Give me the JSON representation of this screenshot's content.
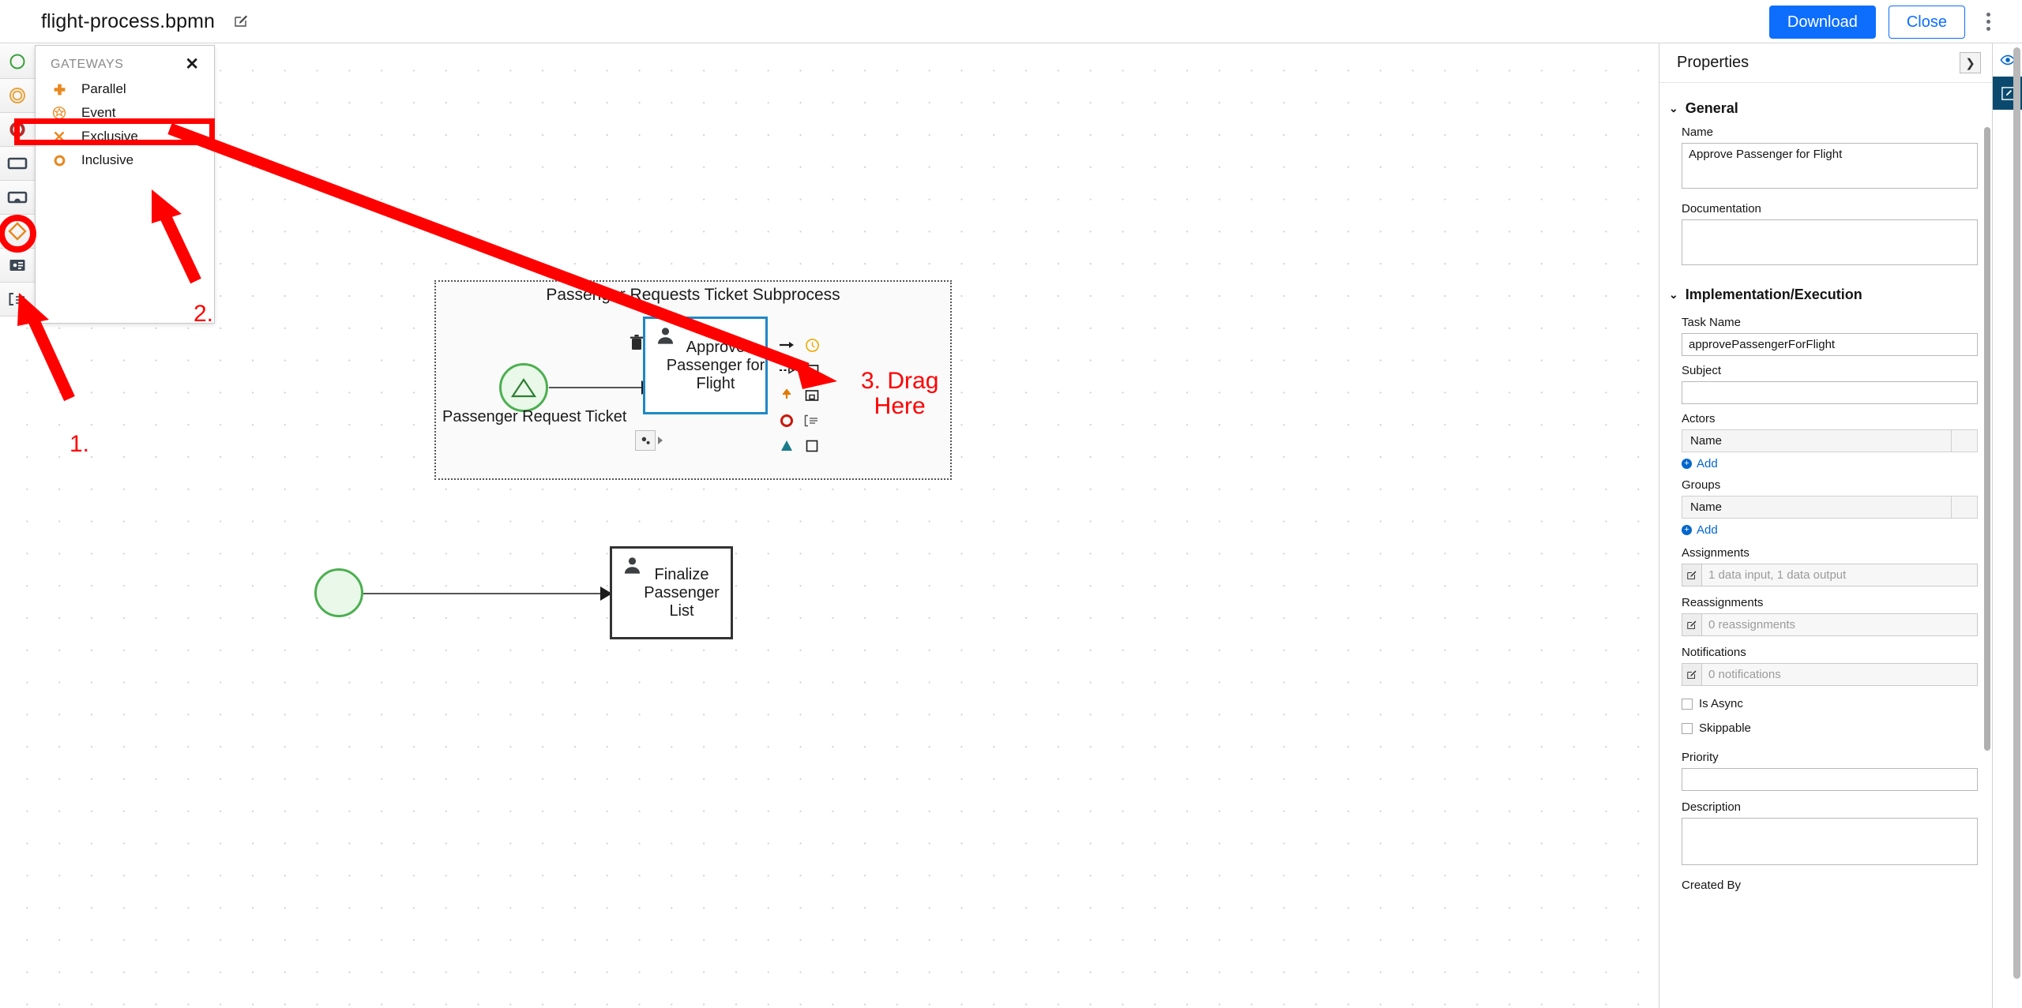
{
  "header": {
    "file_name": "flight-process.bpmn",
    "edit_icon": "edit-pencil-icon",
    "download_label": "Download",
    "close_label": "Close",
    "kebab_icon": "kebab-menu-icon"
  },
  "palette": {
    "items": [
      {
        "name": "start-event-tool",
        "icon": "green-circle-icon"
      },
      {
        "name": "intermediate-event-tool",
        "icon": "orange-double-circle-icon"
      },
      {
        "name": "end-event-tool",
        "icon": "red-circle-icon"
      },
      {
        "name": "task-tool",
        "icon": "rectangle-icon"
      },
      {
        "name": "subprocess-tool",
        "icon": "subprocess-icon"
      },
      {
        "name": "gateway-tool",
        "icon": "orange-diamond-icon"
      },
      {
        "name": "data-object-tool",
        "icon": "data-object-icon"
      },
      {
        "name": "artifact-tool",
        "icon": "artifact-icon"
      }
    ]
  },
  "flyout": {
    "title": "GATEWAYS",
    "close_icon": "close-icon",
    "items": [
      {
        "label": "Parallel",
        "icon": "plus-gateway-icon"
      },
      {
        "label": "Event",
        "icon": "event-gateway-icon"
      },
      {
        "label": "Exclusive",
        "icon": "exclusive-gateway-icon"
      },
      {
        "label": "Inclusive",
        "icon": "inclusive-gateway-icon"
      }
    ],
    "selected": "Exclusive"
  },
  "diagram": {
    "subprocess": {
      "title": "Passenger Requests Ticket Subprocess",
      "start_event_label": "Passenger Request Ticket",
      "task_label": "Approve Passenger for Flight"
    },
    "second_flow": {
      "task_label": "Finalize Passenger List"
    },
    "context_pad": [
      {
        "name": "delete-icon"
      },
      {
        "name": "sequence-flow-icon"
      },
      {
        "name": "timer-event-icon"
      },
      {
        "name": "association-icon"
      },
      {
        "name": "task-icon"
      },
      {
        "name": "gateway-icon"
      },
      {
        "name": "subprocess-icon"
      },
      {
        "name": "end-event-icon"
      },
      {
        "name": "text-annotation-icon"
      },
      {
        "name": "data-input-icon"
      },
      {
        "name": "data-object-icon"
      },
      {
        "name": "morph-icon"
      }
    ]
  },
  "annotations": [
    {
      "id": "step1",
      "text": "1."
    },
    {
      "id": "step2",
      "text": "2."
    },
    {
      "id": "step3",
      "text": "3. Drag\nHere"
    }
  ],
  "annotation_color": "#ff0000",
  "properties": {
    "panel_title": "Properties",
    "collapse_icon": "chevron-right-icon",
    "sections": [
      {
        "name": "General",
        "fields": [
          {
            "label": "Name",
            "value": "Approve Passenger for Flight",
            "type": "textarea"
          },
          {
            "label": "Documentation",
            "value": "",
            "type": "textarea"
          }
        ]
      },
      {
        "name": "Implementation/Execution",
        "fields": [
          {
            "label": "Task Name",
            "value": "approvePassengerForFlight",
            "type": "text"
          },
          {
            "label": "Subject",
            "value": "",
            "type": "text"
          },
          {
            "label": "Actors",
            "type": "grid",
            "column": "Name",
            "add_label": "Add"
          },
          {
            "label": "Groups",
            "type": "grid",
            "column": "Name",
            "add_label": "Add"
          },
          {
            "label": "Assignments",
            "type": "editable",
            "value": "1 data input, 1 data output"
          },
          {
            "label": "Reassignments",
            "type": "editable",
            "value": "0 reassignments"
          },
          {
            "label": "Notifications",
            "type": "editable",
            "value": "0 notifications"
          },
          {
            "label": "Is Async",
            "type": "checkbox",
            "checked": false
          },
          {
            "label": "Skippable",
            "type": "checkbox",
            "checked": false
          },
          {
            "label": "Priority",
            "value": "",
            "type": "text"
          },
          {
            "label": "Description",
            "value": "",
            "type": "textarea"
          },
          {
            "label": "Created By",
            "value": "",
            "type": "text"
          }
        ]
      }
    ]
  },
  "rail": {
    "buttons": [
      {
        "name": "preview-eye-icon",
        "active": false
      },
      {
        "name": "edit-properties-icon",
        "active": true
      }
    ]
  }
}
